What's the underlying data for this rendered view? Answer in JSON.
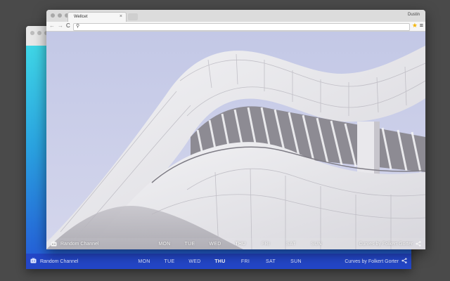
{
  "browser": {
    "tab_title": "Wellcet",
    "tab_close": "×",
    "user_name": "Dustin",
    "nav_back": "←",
    "nav_forward": "→",
    "nav_reload": "C",
    "search_glyph": "⚲",
    "bookmark_glyph": "★",
    "menu_glyph": "≡"
  },
  "overlay_bar": {
    "channel_label": "Random Channel",
    "days": [
      "MON",
      "TUE",
      "WED",
      "THU",
      "FRI",
      "SAT",
      "SUN"
    ],
    "active_day": "THU",
    "credit": "Curves by Folkert Gorter"
  },
  "colors": {
    "bar_blue": "#2346c7",
    "sky": "#c9cde6",
    "back_gradient_top": "#3fd6e6",
    "back_gradient_bottom": "#2458d6"
  },
  "icons": {
    "channel": "tv-icon",
    "share": "share-icon"
  }
}
